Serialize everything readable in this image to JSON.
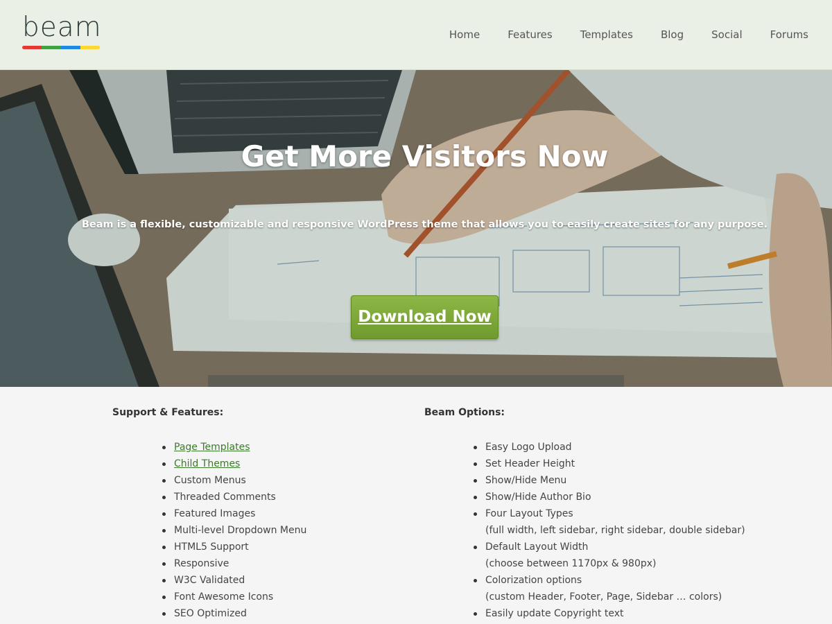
{
  "header": {
    "logo_text": "beam",
    "logo_colors": [
      "#e53935",
      "#43a047",
      "#1e88e5",
      "#fdd835"
    ],
    "nav": [
      "Home",
      "Features",
      "Templates",
      "Blog",
      "Social",
      "Forums"
    ]
  },
  "hero": {
    "title": "Get More Visitors Now",
    "subtitle": "Beam is a flexible, customizable and responsive WordPress theme that allows you to easily create sites for any purpose.",
    "button_label": "Download Now"
  },
  "features": {
    "heading": "Support & Features:",
    "items": [
      {
        "label": "Page Templates",
        "link": true
      },
      {
        "label": "Child Themes",
        "link": true
      },
      {
        "label": "Custom Menus",
        "link": false
      },
      {
        "label": "Threaded Comments",
        "link": false
      },
      {
        "label": "Featured Images",
        "link": false
      },
      {
        "label": "Multi-level Dropdown Menu",
        "link": false
      },
      {
        "label": "HTML5 Support",
        "link": false
      },
      {
        "label": "Responsive",
        "link": false
      },
      {
        "label": "W3C Validated",
        "link": false
      },
      {
        "label": "Font Awesome Icons",
        "link": false
      },
      {
        "label": "SEO Optimized",
        "link": false
      }
    ]
  },
  "options": {
    "heading": "Beam Options:",
    "items": [
      {
        "label": "Easy Logo Upload"
      },
      {
        "label": "Set Header Height"
      },
      {
        "label": "Show/Hide Menu"
      },
      {
        "label": "Show/Hide Author Bio"
      },
      {
        "label": "Four Layout Types",
        "sub": "(full width, left sidebar, right sidebar, double sidebar)"
      },
      {
        "label": "Default Layout Width",
        "sub": "(choose between 1170px & 980px)"
      },
      {
        "label": "Colorization options",
        "sub": "(custom Header, Footer, Page, Sidebar … colors)"
      },
      {
        "label": "Easily update Copyright text"
      }
    ]
  },
  "colors": {
    "header_bg": "#ebf0e7",
    "button_green": "#7aa535",
    "link_green": "#3a7a2a"
  }
}
